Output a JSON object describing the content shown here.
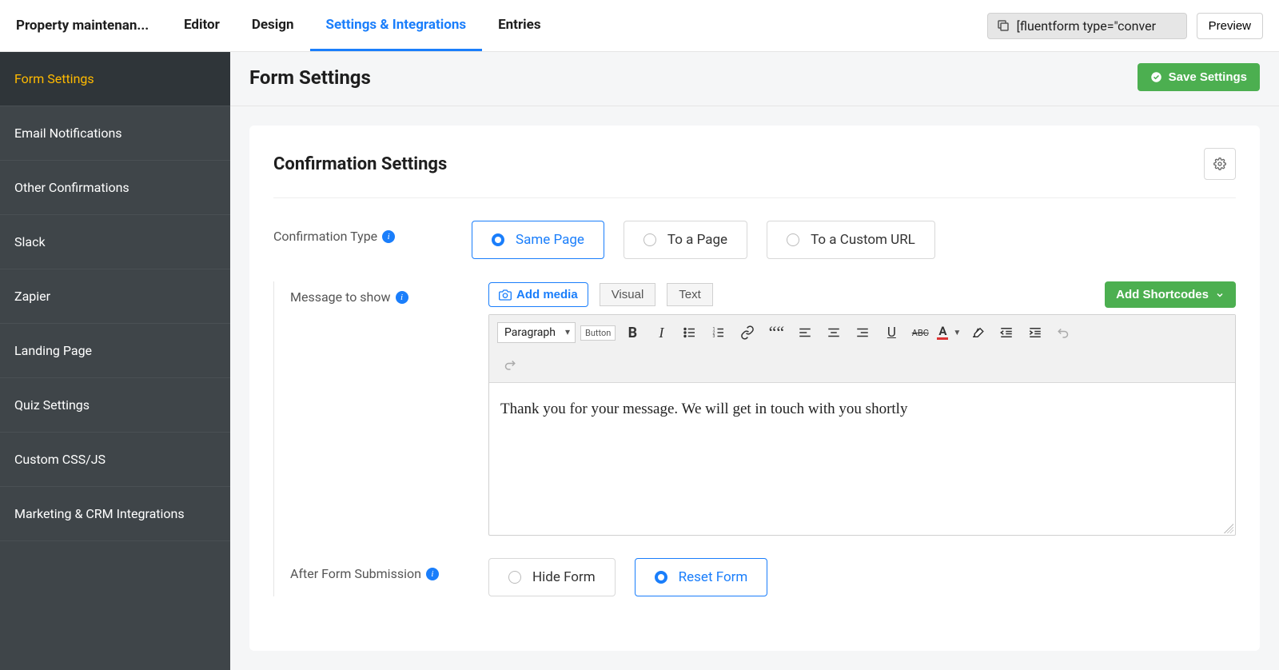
{
  "header": {
    "form_name": "Property maintenan...",
    "tabs": [
      "Editor",
      "Design",
      "Settings & Integrations",
      "Entries"
    ],
    "active_tab": 2,
    "shortcode": "[fluentform type=\"conver",
    "preview": "Preview"
  },
  "sidebar": {
    "items": [
      "Form Settings",
      "Email Notifications",
      "Other Confirmations",
      "Slack",
      "Zapier",
      "Landing Page",
      "Quiz Settings",
      "Custom CSS/JS",
      "Marketing & CRM Integrations"
    ],
    "active": 0
  },
  "page": {
    "title": "Form Settings",
    "save": "Save Settings"
  },
  "confirmation": {
    "title": "Confirmation Settings",
    "type_label": "Confirmation Type",
    "type_options": [
      "Same Page",
      "To a Page",
      "To a Custom URL"
    ],
    "type_selected": 0,
    "message_label": "Message to show",
    "add_media": "Add media",
    "modes": {
      "visual": "Visual",
      "text": "Text"
    },
    "add_shortcodes": "Add Shortcodes",
    "editor": {
      "paragraph": "Paragraph",
      "button_label": "Button",
      "text_color_letter": "A",
      "abc": "ABC",
      "body": "Thank you for your message. We will get in touch with you shortly"
    },
    "after_label": "After Form Submission",
    "after_options": [
      "Hide Form",
      "Reset Form"
    ],
    "after_selected": 1
  }
}
